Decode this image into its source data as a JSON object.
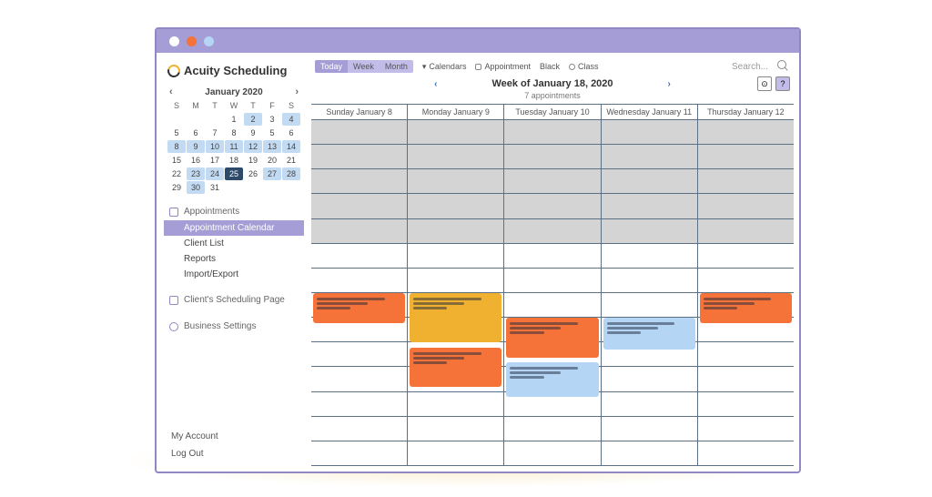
{
  "brand": {
    "name": "Acuity Scheduling"
  },
  "miniCal": {
    "title": "January 2020",
    "dow": [
      "S",
      "M",
      "T",
      "W",
      "T",
      "F",
      "S"
    ],
    "days": [
      {
        "n": "",
        "s": ""
      },
      {
        "n": "",
        "s": ""
      },
      {
        "n": "",
        "s": ""
      },
      {
        "n": "1",
        "s": ""
      },
      {
        "n": "2",
        "s": "hl"
      },
      {
        "n": "3",
        "s": ""
      },
      {
        "n": "4",
        "s": "hl"
      },
      {
        "n": "5",
        "s": ""
      },
      {
        "n": "6",
        "s": ""
      },
      {
        "n": "7",
        "s": ""
      },
      {
        "n": "8",
        "s": ""
      },
      {
        "n": "9",
        "s": ""
      },
      {
        "n": "5",
        "s": ""
      },
      {
        "n": "6",
        "s": ""
      },
      {
        "n": "8",
        "s": "hl"
      },
      {
        "n": "9",
        "s": "hl"
      },
      {
        "n": "10",
        "s": "hl"
      },
      {
        "n": "11",
        "s": "hl"
      },
      {
        "n": "12",
        "s": "hl"
      },
      {
        "n": "13",
        "s": "hl"
      },
      {
        "n": "14",
        "s": "hl"
      },
      {
        "n": "15",
        "s": ""
      },
      {
        "n": "16",
        "s": ""
      },
      {
        "n": "17",
        "s": ""
      },
      {
        "n": "18",
        "s": ""
      },
      {
        "n": "19",
        "s": ""
      },
      {
        "n": "20",
        "s": ""
      },
      {
        "n": "21",
        "s": ""
      },
      {
        "n": "22",
        "s": ""
      },
      {
        "n": "23",
        "s": "hl"
      },
      {
        "n": "24",
        "s": "hl"
      },
      {
        "n": "25",
        "s": "sel"
      },
      {
        "n": "26",
        "s": ""
      },
      {
        "n": "27",
        "s": "hl"
      },
      {
        "n": "28",
        "s": "hl"
      },
      {
        "n": "29",
        "s": ""
      },
      {
        "n": "30",
        "s": "hl"
      },
      {
        "n": "31",
        "s": ""
      },
      {
        "n": "",
        "s": ""
      },
      {
        "n": "",
        "s": ""
      },
      {
        "n": "",
        "s": ""
      },
      {
        "n": "",
        "s": ""
      }
    ]
  },
  "sidebar": {
    "appointments": {
      "head": "Appointments",
      "items": [
        "Appointment Calendar",
        "Client List",
        "Reports",
        "Import/Export"
      ],
      "activeIndex": 0
    },
    "schedulingPage": "Client's Scheduling Page",
    "businessSettings": "Business Settings",
    "myAccount": "My Account",
    "logOut": "Log Out"
  },
  "toolbar": {
    "views": [
      "Today",
      "Week",
      "Month"
    ],
    "calendars": "Calendars",
    "appointment": "Appointment",
    "black": "Black",
    "class": "Class",
    "searchPlaceholder": "Search..."
  },
  "calendar": {
    "title": "Week of January 18, 2020",
    "countText": "7 appointments",
    "helpLabel": "?",
    "columns": [
      "Sunday January 8",
      "Monday January 9",
      "Tuesday January 10",
      "Wednesday January 11",
      "Thursday January 12"
    ],
    "rows": 14,
    "busyRows": [
      0,
      1,
      2,
      3,
      4
    ],
    "events": [
      {
        "col": 0,
        "row": 7,
        "span": 1.2,
        "color": "orange"
      },
      {
        "col": 1,
        "row": 7,
        "span": 2,
        "color": "yellow"
      },
      {
        "col": 1,
        "row": 9.2,
        "span": 1.6,
        "color": "orange"
      },
      {
        "col": 2,
        "row": 8,
        "span": 1.6,
        "color": "orange"
      },
      {
        "col": 2,
        "row": 9.8,
        "span": 1.4,
        "color": "blue"
      },
      {
        "col": 3,
        "row": 8,
        "span": 1.3,
        "color": "blue"
      },
      {
        "col": 4,
        "row": 7,
        "span": 1.2,
        "color": "orange"
      }
    ]
  }
}
